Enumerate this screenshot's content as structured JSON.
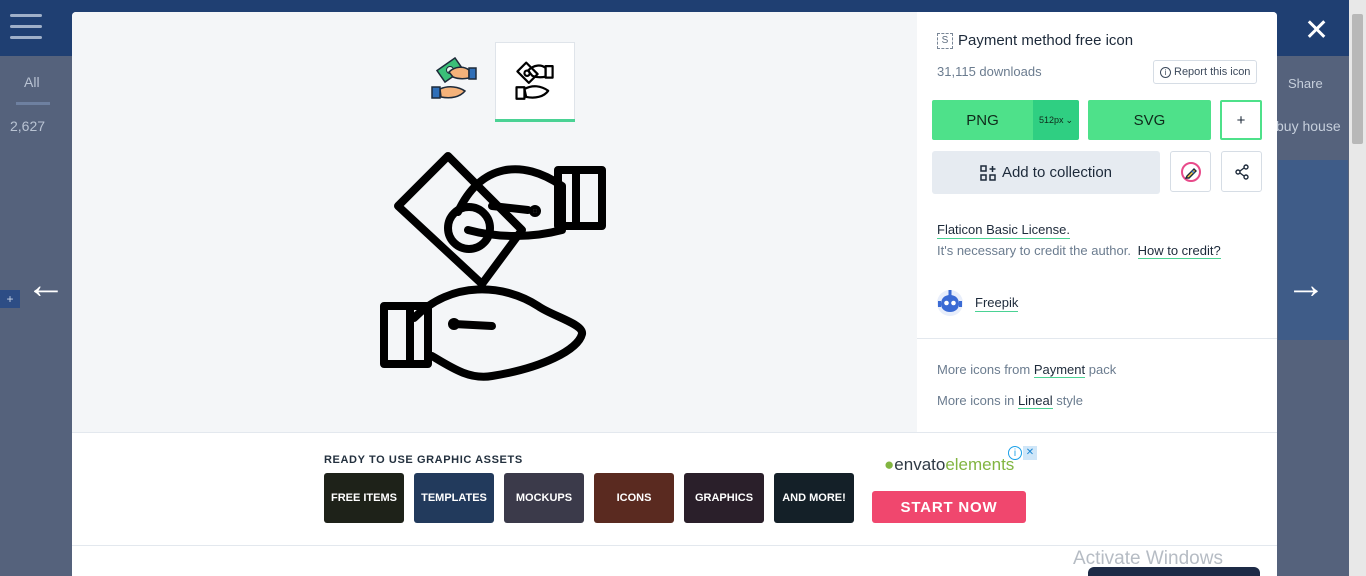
{
  "background": {
    "tab_all": "All",
    "count_text": "2,627",
    "share_label": "Share",
    "buy_text": "buy house",
    "plus": "+"
  },
  "nav": {
    "prev_glyph": "←",
    "next_glyph": "→",
    "close_glyph": "✕"
  },
  "icon": {
    "badge": "S",
    "title": "Payment method free icon",
    "downloads": "31,115 downloads",
    "report_label": "Report this icon",
    "info_glyph": "i"
  },
  "download": {
    "png_label": "PNG",
    "size_label": "512px",
    "size_chevron": "⌄",
    "svg_label": "SVG",
    "plus_label": "+"
  },
  "actions": {
    "collection_label": "Add to collection"
  },
  "license": {
    "name": "Flaticon Basic License.",
    "credit_text": "It's necessary to credit the author.",
    "credit_link": "How to credit?"
  },
  "author": {
    "name": "Freepik"
  },
  "more": {
    "pack_prefix": "More icons from",
    "pack_link": "Payment",
    "pack_suffix": "pack",
    "style_prefix": "More icons in",
    "style_link": "Lineal",
    "style_suffix": "style"
  },
  "ad": {
    "label": "READY TO USE GRAPHIC ASSETS",
    "tiles": [
      {
        "label": "FREE ITEMS",
        "color": "#1e2219"
      },
      {
        "label": "TEMPLATES",
        "color": "#223a5c"
      },
      {
        "label": "MOCKUPS",
        "color": "#3b3a4a"
      },
      {
        "label": "ICONS",
        "color": "#5a2a20"
      },
      {
        "label": "GRAPHICS",
        "color": "#2a1f2a"
      },
      {
        "label": "AND MORE!",
        "color": "#142028"
      }
    ],
    "brand_leaf": "●",
    "brand_main": "envato",
    "brand_elements": "elements",
    "info_glyph": "i",
    "close_glyph": "✕",
    "cta": "START NOW"
  },
  "os_overlay": {
    "activate_text": "Activate Windows"
  },
  "colors": {
    "accent_green": "#4ee18a",
    "cta_pink": "#f0476e",
    "link_underline": "#4ad294"
  }
}
